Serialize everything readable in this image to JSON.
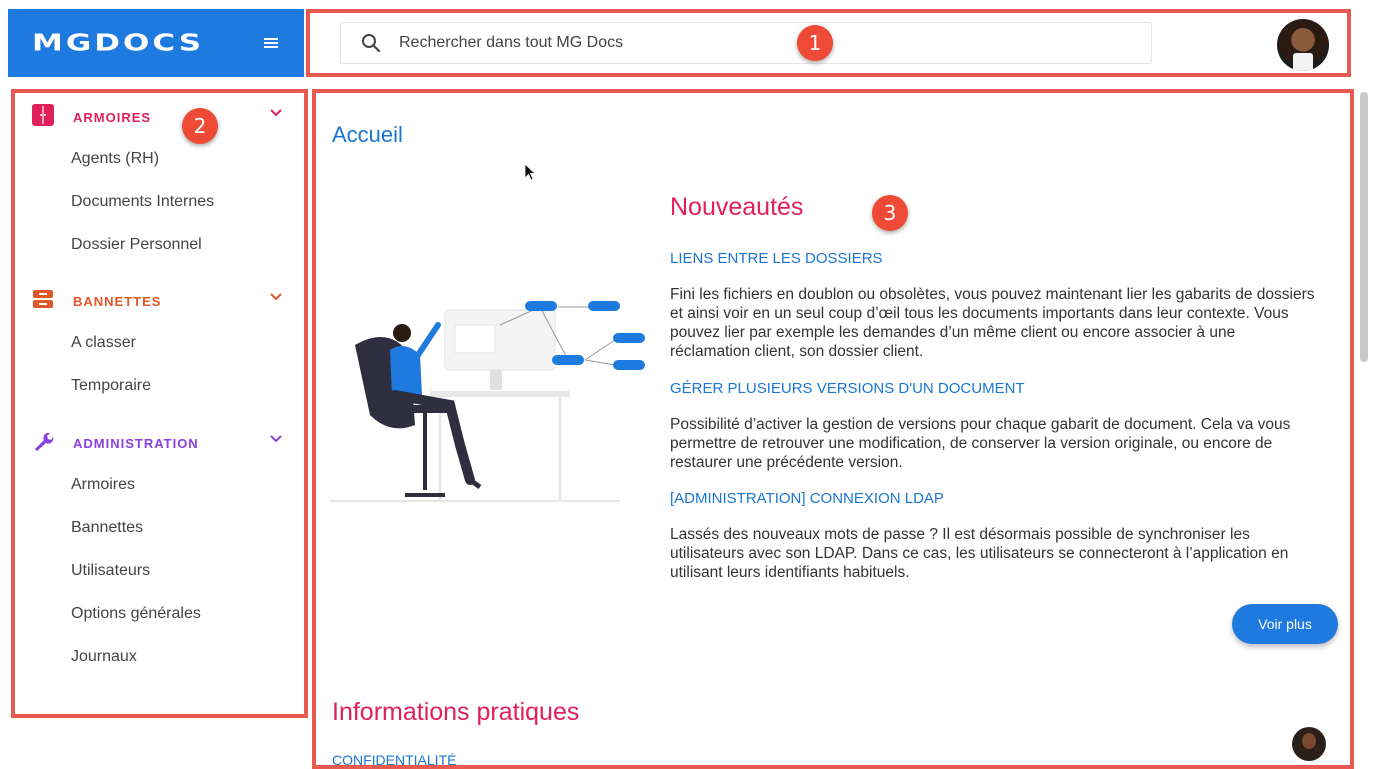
{
  "brand": {
    "logo_text": "MGDOCS",
    "color": "#1f7ae0"
  },
  "header": {
    "menu_icon": "hamburger-icon",
    "search_icon": "search-icon",
    "search_placeholder": "Rechercher dans tout MG Docs",
    "avatar": "user-avatar"
  },
  "annotations": [
    "1",
    "2",
    "3"
  ],
  "sidebar": {
    "sections": [
      {
        "label": "ARMOIRES",
        "icon": "cabinet-icon",
        "color": "#e0205a",
        "items": [
          "Agents (RH)",
          "Documents Internes",
          "Dossier Personnel"
        ]
      },
      {
        "label": "BANNETTES",
        "icon": "tray-icon",
        "color": "#e0572a",
        "items": [
          "A classer",
          "Temporaire"
        ]
      },
      {
        "label": "ADMINISTRATION",
        "icon": "wrench-icon",
        "color": "#8a3fe0",
        "items": [
          "Armoires",
          "Bannettes",
          "Utilisateurs",
          "Options générales",
          "Journaux"
        ]
      }
    ]
  },
  "main": {
    "title": "Accueil",
    "news_title": "Nouveautés",
    "news": [
      {
        "title": "LIENS ENTRE LES DOSSIERS",
        "lines": [
          "Fini les fichiers en doublon ou obsolètes, vous pouvez maintenant lier les gabarits de dossiers",
          "et ainsi voir en un seul coup d’œil tous les documents importants dans leur contexte. Vous",
          "pouvez lier par exemple les demandes d’un même client ou encore associer à une",
          "réclamation client, son dossier client."
        ]
      },
      {
        "title": "GÉRER PLUSIEURS VERSIONS D'UN DOCUMENT",
        "lines": [
          "Possibilité d’activer la gestion de versions pour chaque gabarit de document. Cela va vous",
          "permettre de retrouver une modification, de conserver la version originale, ou encore de",
          "restaurer une précédente version."
        ]
      },
      {
        "title": "[ADMINISTRATION] CONNEXION LDAP",
        "lines": [
          "Lassés des nouveaux mots de passe ? Il est désormais possible de synchroniser les",
          "utilisateurs avec son LDAP. Dans ce cas, les utilisateurs se connecteront à l’application en",
          "utilisant leurs identifiants habituels."
        ]
      }
    ],
    "more_button": "Voir plus",
    "info_title": "Informations pratiques",
    "info_link": "CONFIDENTIALITÉ"
  },
  "colors": {
    "accent": "#1f7ae0",
    "heading_pink": "#e0205a",
    "link_blue": "#1a76d2",
    "annotation_red": "#e85a4f"
  }
}
